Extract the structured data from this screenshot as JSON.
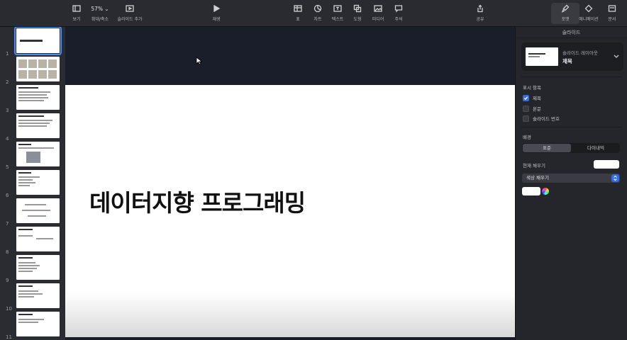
{
  "toolbar": {
    "view_label": "보기",
    "zoom_value": "57% ⌄",
    "zoom_label": "확대/축소",
    "add_slide_label": "슬라이드 추가",
    "play_label": "재생",
    "table_label": "표",
    "chart_label": "차트",
    "text_label": "텍스트",
    "shape_label": "도형",
    "media_label": "미디어",
    "comment_label": "주석",
    "share_label": "공유",
    "format_label": "포맷",
    "animate_label": "애니메이션",
    "document_label": "문서"
  },
  "thumbnails": [
    {
      "num": "1"
    },
    {
      "num": "2"
    },
    {
      "num": "3"
    },
    {
      "num": "4"
    },
    {
      "num": "5"
    },
    {
      "num": "6"
    },
    {
      "num": "7"
    },
    {
      "num": "8"
    },
    {
      "num": "9"
    },
    {
      "num": "10"
    },
    {
      "num": "11"
    }
  ],
  "slide": {
    "title": "데이터지향 프로그래밍"
  },
  "inspector": {
    "header": "슬라이드",
    "layout_sub": "슬라이드 레이아웃",
    "layout_name": "제목",
    "display_items_label": "표시 항목",
    "items": [
      {
        "label": "제목",
        "checked": true
      },
      {
        "label": "본문",
        "checked": false
      },
      {
        "label": "슬라이드 번호",
        "checked": false
      }
    ],
    "background_label": "배경",
    "seg_standard": "표준",
    "seg_dynamic": "다이내믹",
    "current_fill_label": "현재 채우기",
    "fill_select": "색상 채우기"
  },
  "colors": {
    "accent": "#2f6fe0",
    "selection": "#4a8ef5"
  }
}
